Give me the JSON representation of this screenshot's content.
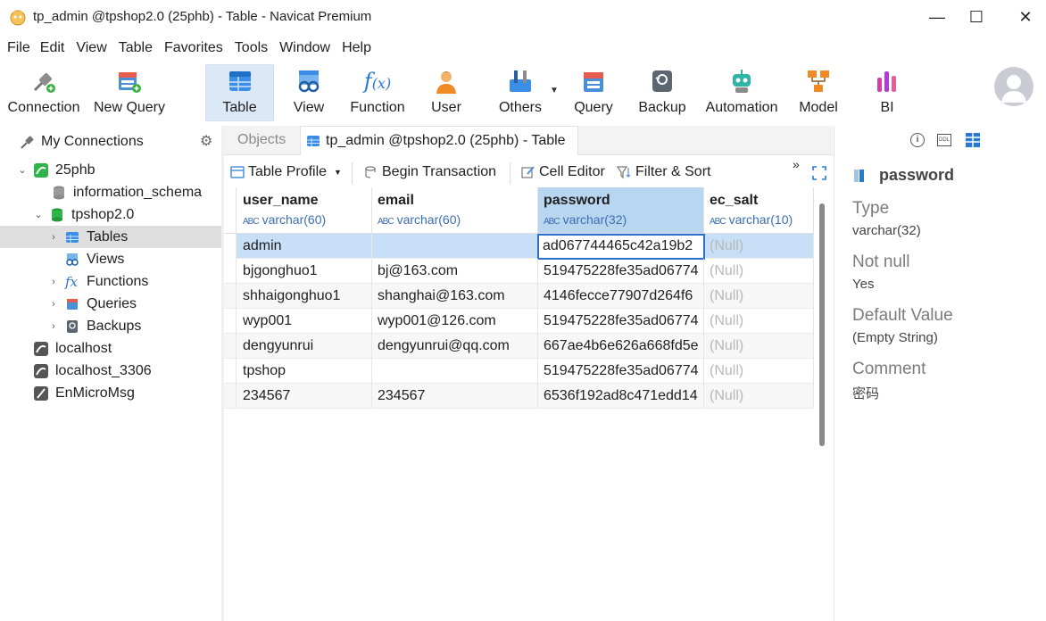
{
  "window": {
    "title": "tp_admin @tpshop2.0 (25phb) - Table - Navicat Premium",
    "minimize": "—",
    "maximize": "☐",
    "close": "✕"
  },
  "menu": [
    "File",
    "Edit",
    "View",
    "Table",
    "Favorites",
    "Tools",
    "Window",
    "Help"
  ],
  "toolbar": {
    "connection": "Connection",
    "new_query": "New Query",
    "table": "Table",
    "view": "View",
    "function": "Function",
    "user": "User",
    "others": "Others",
    "query": "Query",
    "backup": "Backup",
    "automation": "Automation",
    "model": "Model",
    "bi": "BI"
  },
  "sidebar": {
    "header": "My Connections",
    "items": [
      {
        "label": "25phb"
      },
      {
        "label": "information_schema"
      },
      {
        "label": "tpshop2.0"
      },
      {
        "label": "Tables"
      },
      {
        "label": "Views"
      },
      {
        "label": "Functions"
      },
      {
        "label": "Queries"
      },
      {
        "label": "Backups"
      },
      {
        "label": "localhost"
      },
      {
        "label": "localhost_3306"
      },
      {
        "label": "EnMicroMsg"
      }
    ]
  },
  "tabs": {
    "objects": "Objects",
    "active": "tp_admin @tpshop2.0 (25phb) - Table"
  },
  "subtoolbar": {
    "table_profile": "Table Profile",
    "begin_transaction": "Begin Transaction",
    "cell_editor": "Cell Editor",
    "filter_sort": "Filter & Sort",
    "more": "»"
  },
  "grid": {
    "columns": [
      {
        "name": "user_name",
        "type": "varchar(60)"
      },
      {
        "name": "email",
        "type": "varchar(60)"
      },
      {
        "name": "password",
        "type": "varchar(32)"
      },
      {
        "name": "ec_salt",
        "type": "varchar(10)"
      }
    ],
    "abc": "ABC",
    "rows": [
      [
        "admin",
        "",
        "ad067744465c42a19b2",
        "(Null)"
      ],
      [
        "bjgonghuo1",
        "bj@163.com",
        "519475228fe35ad06774",
        "(Null)"
      ],
      [
        "shhaigonghuo1",
        "shanghai@163.com",
        "4146fecce77907d264f6",
        "(Null)"
      ],
      [
        "wyp001",
        "wyp001@126.com",
        "519475228fe35ad06774",
        "(Null)"
      ],
      [
        "dengyunrui",
        "dengyunrui@qq.com",
        "667ae4b6e626a668fd5e",
        "(Null)"
      ],
      [
        "tpshop",
        "",
        "519475228fe35ad06774",
        "(Null)"
      ],
      [
        "234567",
        "234567",
        "6536f192ad8c471edd14",
        "(Null)"
      ]
    ]
  },
  "details": {
    "field_name": "password",
    "type_label": "Type",
    "type_value": "varchar(32)",
    "notnull_label": "Not null",
    "notnull_value": "Yes",
    "default_label": "Default Value",
    "default_value": "(Empty String)",
    "comment_label": "Comment",
    "comment_value": "密码",
    "ddl_label": "DDL"
  }
}
